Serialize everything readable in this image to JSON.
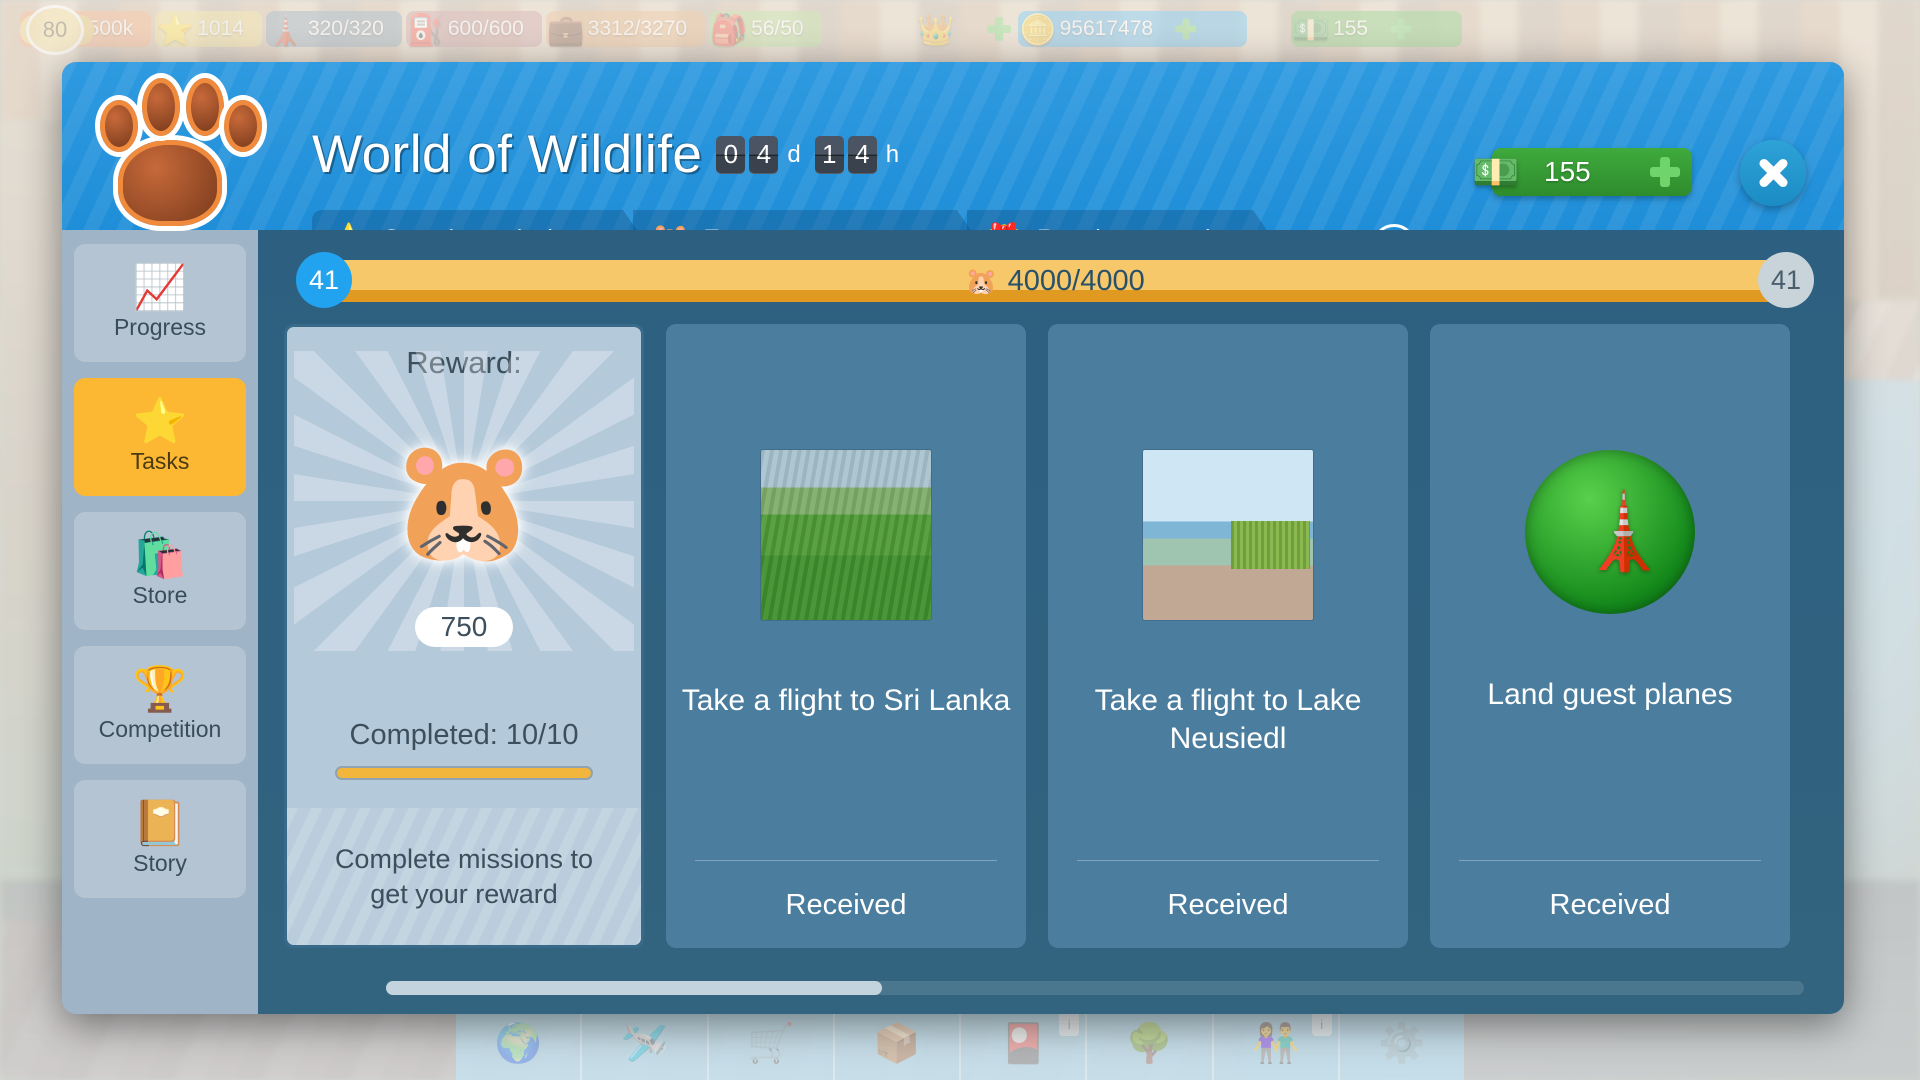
{
  "topbar": {
    "resources": [
      {
        "name": "level",
        "icon": "wing-badge-icon",
        "value": "80",
        "color": "#f2d98a"
      },
      {
        "name": "coins",
        "icon": "coin-icon",
        "value": "8500k",
        "color": "#f0a06a"
      },
      {
        "name": "stars",
        "icon": "star-icon",
        "value": "1014",
        "color": "#e8d37a"
      },
      {
        "name": "water",
        "icon": "water-tower-icon",
        "value": "320/320",
        "color": "#7c94a4"
      },
      {
        "name": "fuel",
        "icon": "fuel-can-icon",
        "value": "600/600",
        "color": "#c08a8a"
      },
      {
        "name": "cargo",
        "icon": "briefcase-icon",
        "value": "3312/3270",
        "color": "#e0a870"
      },
      {
        "name": "backpack",
        "icon": "backpack-icon",
        "value": "56/50",
        "color": "#a8d280"
      },
      {
        "name": "crown",
        "icon": "crown-icon",
        "value": "",
        "color": "#dfe4e8"
      },
      {
        "name": "gold",
        "icon": "gold-coins-icon",
        "value": "95617478",
        "color": "#49aee8"
      },
      {
        "name": "cash",
        "icon": "cash-icon",
        "value": "155",
        "color": "#6fbe5c"
      }
    ]
  },
  "modal": {
    "logo_icon": "paw-print-icon",
    "title": "World of Wildlife",
    "timer": {
      "days_digits": [
        "0",
        "4"
      ],
      "days_unit": "d",
      "hours_digits": [
        "1",
        "4"
      ],
      "hours_unit": "h"
    },
    "steps": [
      {
        "icon": "star-icon",
        "label": "Complete missions"
      },
      {
        "icon": "hamster-icon",
        "label": "Earn event currency"
      },
      {
        "icon": "gift-icon",
        "label": "Receive rewards"
      }
    ],
    "info_button": {
      "icon": "info-icon",
      "label": "i"
    },
    "currency": {
      "icon": "cash-icon",
      "value": "155",
      "add_icon": "plus-icon"
    },
    "close_button": {
      "icon": "close-icon"
    }
  },
  "sidebar": {
    "items": [
      {
        "icon": "chart-growth-icon",
        "label": "Progress",
        "active": false
      },
      {
        "icon": "star-icon",
        "label": "Tasks",
        "active": true
      },
      {
        "icon": "shopping-bag-icon",
        "label": "Store",
        "active": false
      },
      {
        "icon": "trophy-icon",
        "label": "Competition",
        "active": false
      },
      {
        "icon": "book-icon",
        "label": "Story",
        "active": false
      }
    ]
  },
  "level_bar": {
    "left_level": "41",
    "right_level": "41",
    "currency_icon": "hamster-icon",
    "progress_text": "4000/4000",
    "current": 4000,
    "max": 4000,
    "percent": 100
  },
  "reward_card": {
    "title": "Reward:",
    "art_icon": "hamster-icon",
    "amount": "750",
    "completed_label": "Completed: 10/10",
    "completed_current": 10,
    "completed_max": 10,
    "completed_percent": 100,
    "footer_text": "Complete missions to get your reward"
  },
  "task_cards": [
    {
      "thumb": "sri-lanka-tea-plantation-thumb",
      "title": "Take a flight to Sri Lanka",
      "status": "Received"
    },
    {
      "thumb": "lake-neusiedl-thumb",
      "title": "Take a flight to Lake Neusiedl",
      "status": "Received"
    },
    {
      "thumb": "radar-tower-icon",
      "title": "Land guest planes",
      "status": "Received"
    }
  ],
  "scrollbar": {
    "thumb_percent": 35,
    "thumb_offset": 0
  },
  "bottombar": {
    "tools": [
      {
        "icon": "world-flight-icon",
        "badge": ""
      },
      {
        "icon": "hangar-icon",
        "badge": ""
      },
      {
        "icon": "shopping-cart-icon",
        "badge": ""
      },
      {
        "icon": "crate-icon",
        "badge": ""
      },
      {
        "icon": "treasure-chest-icon",
        "badge": "i"
      },
      {
        "icon": "land-plot-icon",
        "badge": ""
      },
      {
        "icon": "people-icon",
        "badge": "i"
      },
      {
        "icon": "settings-gear-icon",
        "badge": ""
      }
    ]
  }
}
